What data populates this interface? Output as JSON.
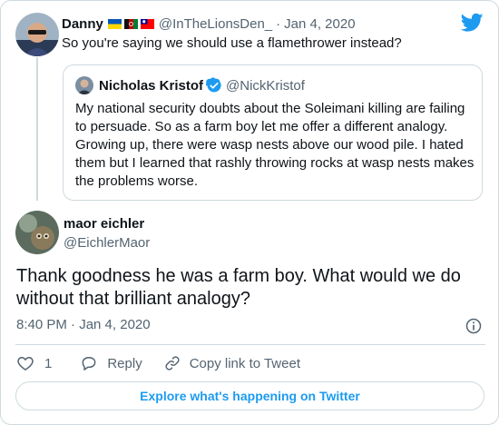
{
  "retweeted": {
    "name": "Danny",
    "handle": "@InTheLionsDen_",
    "separator": "·",
    "date": "Jan 4, 2020",
    "text": "So you're saying we should use a flamethrower instead?",
    "flags": [
      "ukraine-flag-icon",
      "afghanistan-flag-icon",
      "taiwan-flag-icon"
    ]
  },
  "quoted": {
    "name": "Nicholas Kristof",
    "handle": "@NickKristof",
    "text": "My national security doubts about the Soleimani killing are failing to persuade. So as a farm boy let me offer a different analogy. Growing up, there were wasp nests above our wood pile. I hated them but I learned that rashly throwing rocks at wasp nests makes the problems worse."
  },
  "main": {
    "name": "maor eichler",
    "handle": "@EichlerMaor",
    "text": "Thank goodness he was a farm boy. What would we do without that brilliant analogy?",
    "timestamp": "8:40 PM · Jan 4, 2020"
  },
  "actions": {
    "like_count": "1",
    "reply_label": "Reply",
    "copy_label": "Copy link to Tweet"
  },
  "explore_label": "Explore what's happening on Twitter",
  "colors": {
    "twitter_blue": "#1d9bf0",
    "text": "#0f1419",
    "secondary": "#536471",
    "border": "#cfd9de"
  }
}
